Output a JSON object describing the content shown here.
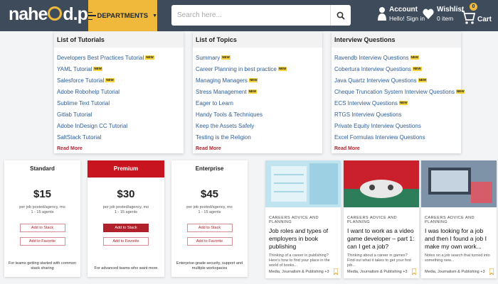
{
  "header": {
    "logo": "nahe d.pk",
    "logo_left": "nahe",
    "logo_right": "d.pk",
    "departments_label": "DEPARTMENTS",
    "search_placeholder": "Search here...",
    "account_title": "Account",
    "account_sub": "Hello! Sign in",
    "wishlist_title": "Wishlist",
    "wishlist_sub": "0 item",
    "cart_label": "Cart",
    "cart_count": "0",
    "colors": {
      "bar": "#3d4b5b",
      "accent": "#f0b93b"
    }
  },
  "menu": [
    {
      "heading": "List of Tutorials",
      "items": [
        {
          "label": "Developers Best Practices Tutorial",
          "new": true
        },
        {
          "label": "YAML Tutorial",
          "new": true
        },
        {
          "label": "Salesforce Tutorial",
          "new": true
        },
        {
          "label": "Adobe Robohelp Tutorial",
          "new": false
        },
        {
          "label": "Sublime Text Tutorial",
          "new": false
        },
        {
          "label": "Gitlab Tutorial",
          "new": false
        },
        {
          "label": "Adobe InDesign CC Tutorial",
          "new": false
        },
        {
          "label": "SaltStack Tutorial",
          "new": false
        }
      ],
      "read_more": "Read More"
    },
    {
      "heading": "List of Topics",
      "items": [
        {
          "label": "Summary",
          "new": true
        },
        {
          "label": "Career Planning in best practice",
          "new": true
        },
        {
          "label": "Managing Managers",
          "new": true
        },
        {
          "label": "Stress Management",
          "new": true
        },
        {
          "label": "Eager to Learn",
          "new": false
        },
        {
          "label": "Handy Tools & Techniques",
          "new": false
        },
        {
          "label": "Keep the Assets Safely",
          "new": false
        },
        {
          "label": "Testing is the Religion",
          "new": false
        }
      ],
      "read_more": "Read More"
    },
    {
      "heading": "Interview Questions",
      "items": [
        {
          "label": "Ravendb Interview Questions",
          "new": true
        },
        {
          "label": "Cobertura Interview Questions",
          "new": true
        },
        {
          "label": "Java Quartz Interview Questions",
          "new": true
        },
        {
          "label": "Cheque Truncation System Interview Questions",
          "new": true
        },
        {
          "label": "ECS Interview Questions",
          "new": true
        },
        {
          "label": "RTGS Interview Questions",
          "new": false
        },
        {
          "label": "Private Equity Interview Questions",
          "new": false
        },
        {
          "label": "Excel Formulas Interview Questions",
          "new": false
        }
      ],
      "read_more": "Read More"
    }
  ],
  "new_badge": "NEW",
  "pricing": [
    {
      "name": "Standard",
      "price": "$15",
      "desc1": "per job posted/agency, mo",
      "desc2": "1 - 15 agents",
      "stack": "Add to Stack",
      "favorite": "Add to Favorite",
      "text": "For teams getting started with common stack sharing"
    },
    {
      "name": "Premium",
      "price": "$30",
      "desc1": "per job posted/agency, mo",
      "desc2": "1 - 15 agents",
      "stack": "Add to Stack",
      "favorite": "Add to Favorite",
      "text": "For advanced teams who want more"
    },
    {
      "name": "Enterprise",
      "price": "$45",
      "desc1": "per job posted/agency, mo",
      "desc2": "1 - 15 agents",
      "stack": "Add to Stack",
      "favorite": "Add to Favorite",
      "text": "Enterprise-grade security, support and multiple workspaces"
    }
  ],
  "articles": [
    {
      "category": "CAREERS ADVICE AND PLANNING",
      "title": "Job roles and types of employers in book publishing",
      "excerpt": "Thinking of a career in publishing? Here's how to find your place in the world of books...",
      "source": "Media, Journalism & Publishing +3"
    },
    {
      "category": "CAREERS ADVICE AND PLANNING",
      "title": "I want to work as a video game developer – part 1: can I get a job?",
      "excerpt": "Thinking about a career in games? Find out what it takes to get your first job...",
      "source": "Media, Journalism & Publishing +3"
    },
    {
      "category": "CAREERS ADVICE AND PLANNING",
      "title": "I was looking for a job and then I found a job I make my own work...",
      "excerpt": "Notes on a job search that turned into something new...",
      "source": "Media, Journalism & Publishing +3"
    }
  ]
}
